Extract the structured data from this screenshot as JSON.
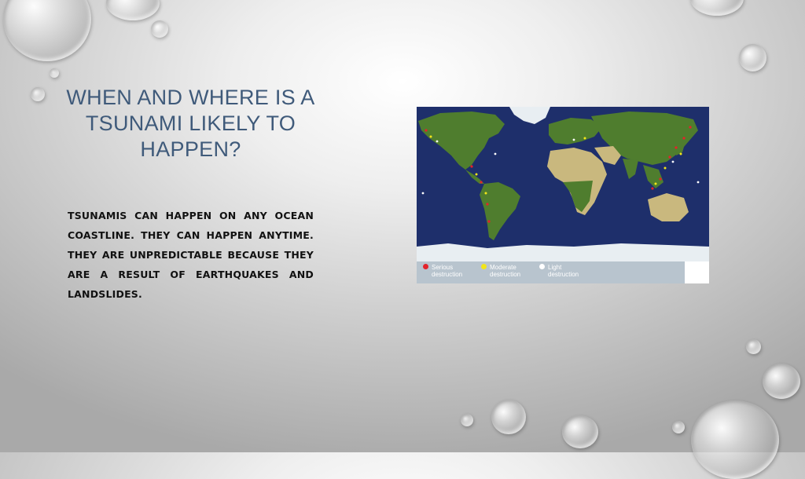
{
  "slide": {
    "title": "WHEN AND WHERE IS A TSUNAMI LIKELY TO HAPPEN?",
    "body": "TSUNAMIS CAN HAPPEN ON ANY OCEAN COASTLINE.  THEY CAN HAPPEN ANYTIME.  THEY ARE UNPREDICTABLE BECAUSE THEY ARE A RESULT OF EARTHQUAKES AND LANDSLIDES."
  },
  "map": {
    "legend": [
      {
        "label": "Serious destruction",
        "color": "#e3232b"
      },
      {
        "label": "Moderate destruction",
        "color": "#f2e51a"
      },
      {
        "label": "Light destruction",
        "color": "#ffffff"
      }
    ],
    "colors": {
      "ocean": "#1e2f6b",
      "land": "#4f7d2e",
      "desert": "#c9b87e",
      "ice": "#e8eef2"
    }
  }
}
